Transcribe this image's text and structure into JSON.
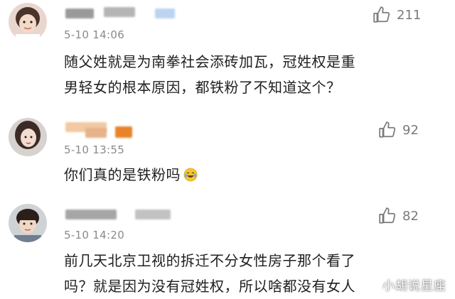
{
  "comments": [
    {
      "timestamp": "5-10 14:06",
      "like_count": "211",
      "text_lines": [
        "随父姓就是为南拳社会添砖加瓦，冠姓权是重",
        "男轻女的根本原因，都铁粉了不知道这个？"
      ]
    },
    {
      "timestamp": "5-10 13:55",
      "like_count": "92",
      "text": "你们真的是铁粉吗",
      "emoji": "laughing-tears-emoji"
    },
    {
      "timestamp": "5-10 14:20",
      "like_count": "82",
      "text_lines": [
        "前几天北京卫视的拆迁不分女性房子那个看了",
        "吗？就是因为没有冠姓权，所以啥都没有女人"
      ]
    }
  ],
  "watermark": "小胡说星座",
  "icons": {
    "like": "thumbs-up-icon"
  },
  "colors": {
    "timestamp": "#8a8a8a",
    "like": "#7a7a7a",
    "text": "#202020"
  }
}
